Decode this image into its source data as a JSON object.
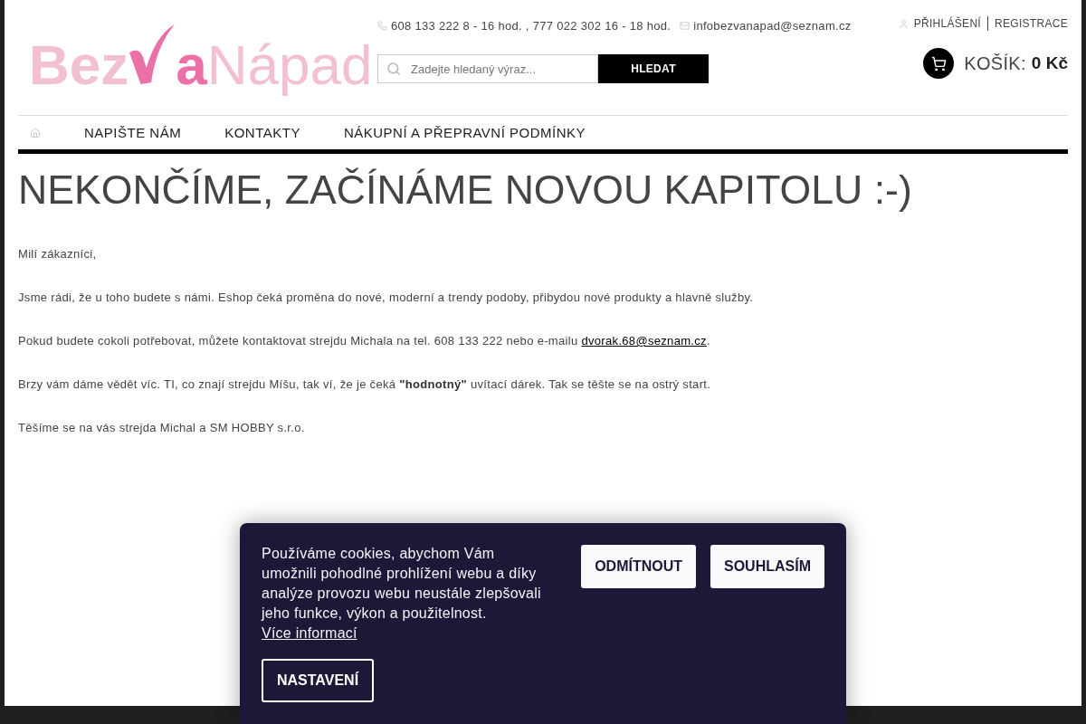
{
  "header": {
    "logo": {
      "text_start": "Bez",
      "text_accent": "a",
      "text_end": "Nápad"
    },
    "contact": {
      "phone": "608 133 222 8 - 16 hod. , 777 022 302 16 - 18 hod.",
      "email": "infobezvanapad@seznam.cz"
    },
    "search": {
      "placeholder": "Zadejte hledaný výraz...",
      "button": "HLEDAT"
    },
    "account": {
      "login": "PŘIHLÁŠENÍ",
      "register": "REGISTRACE"
    },
    "cart": {
      "label": "KOŠÍK:",
      "total": "0 Kč"
    }
  },
  "nav": {
    "items": [
      "NAPIŠTE NÁM",
      "KONTAKTY",
      "NÁKUPNÍ A PŘEPRAVNÍ PODMÍNKY"
    ]
  },
  "content": {
    "title": "NEKONČÍME, ZAČÍNÁME NOVOU KAPITOLU :-)",
    "paragraphs": [
      {
        "text": "Milí zákazníci,"
      },
      {
        "text": "Jsme rádi, že u toho budete s námi. Eshop čeká proměna do nové, moderní a trendy podoby, přibydou nové produkty a hlavně služby."
      },
      {
        "text": "Pokud budete cokoli potřebovat, můžete kontaktovat strejdu Michala na tel. 608 133 222 nebo e-mailu ",
        "link": "dvorak.68@seznam.cz",
        "after": "."
      },
      {
        "text": "Brzy vám dáme vědět víc. TI, co znají strejdu Míšu, tak ví, že je čeká **\"hodnotný\"** uvítací dárek. Tak se těšte se na ostrý start."
      },
      {
        "text": "Těšíme se na vás strejda Michal a SM HOBBY s.r.o."
      }
    ]
  },
  "cookie_bar": {
    "text": "Používáme cookies, abychom Vám umožnili pohodlné prohlížení webu a díky analýze provozu webu neustále zlepšovali jeho funkce, výkon a použitelnost.",
    "more_link": "Více informací",
    "buttons": [
      {
        "label": "ODMÍTNOUT",
        "kind": "solid"
      },
      {
        "label": "SOUHLASÍM",
        "kind": "solid"
      },
      {
        "label": "NASTAVENÍ",
        "kind": "outline"
      }
    ]
  }
}
